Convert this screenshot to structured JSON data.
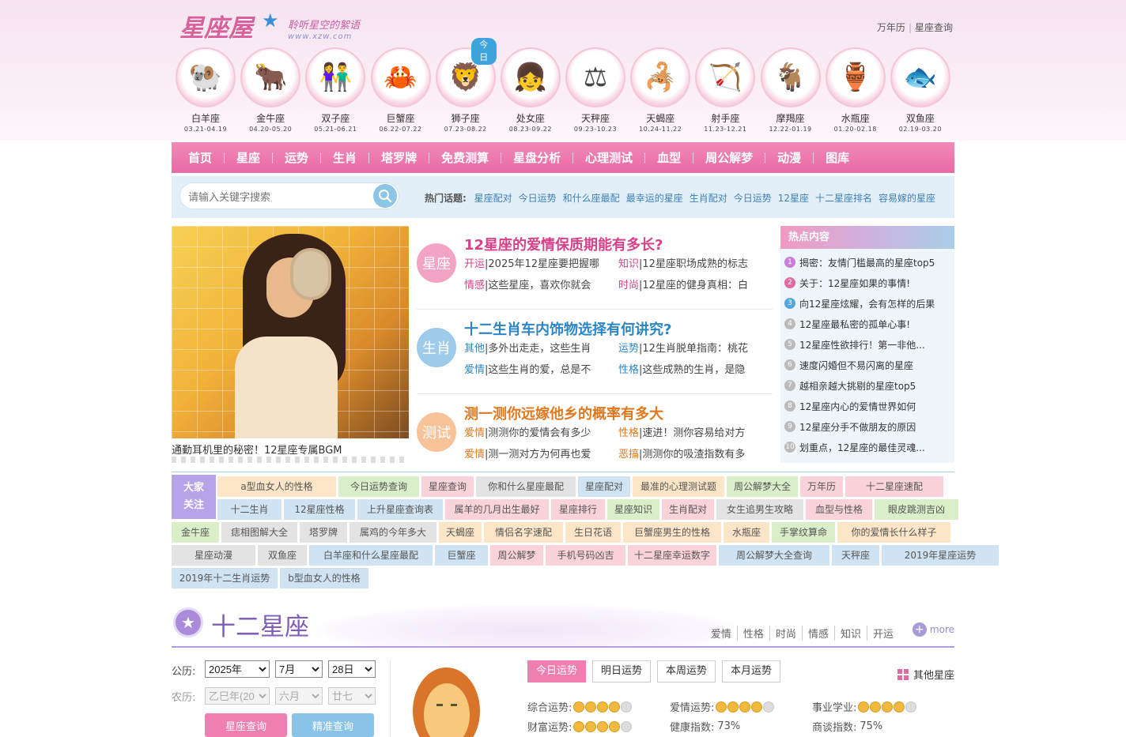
{
  "header": {
    "logo_text": "星座屋",
    "slogan": "聆听星空的絮语",
    "url": "www.xzw.com",
    "toplinks": [
      "万年历",
      "星座查询"
    ],
    "today_tag": "今日"
  },
  "signs": [
    {
      "name": "白羊座",
      "date": "03.21-04.19",
      "icon": "ram-icon"
    },
    {
      "name": "金牛座",
      "date": "04.20-05.20",
      "icon": "bull-icon"
    },
    {
      "name": "双子座",
      "date": "05.21-06.21",
      "icon": "twins-icon"
    },
    {
      "name": "巨蟹座",
      "date": "06.22-07.22",
      "icon": "crab-icon"
    },
    {
      "name": "狮子座",
      "date": "07.23-08.22",
      "icon": "lion-icon"
    },
    {
      "name": "处女座",
      "date": "08.23-09.22",
      "icon": "maiden-icon"
    },
    {
      "name": "天秤座",
      "date": "09.23-10.23",
      "icon": "scales-icon"
    },
    {
      "name": "天蝎座",
      "date": "10.24-11.22",
      "icon": "scorpion-icon"
    },
    {
      "name": "射手座",
      "date": "11.23-12.21",
      "icon": "archer-icon"
    },
    {
      "name": "摩羯座",
      "date": "12.22-01.19",
      "icon": "goat-icon"
    },
    {
      "name": "水瓶座",
      "date": "01.20-02.18",
      "icon": "water-bearer-icon"
    },
    {
      "name": "双鱼座",
      "date": "02.19-03.20",
      "icon": "fish-icon"
    }
  ],
  "nav": [
    "首页",
    "星座",
    "运势",
    "生肖",
    "塔罗牌",
    "免费测算",
    "星盘分析",
    "心理测试",
    "血型",
    "周公解梦",
    "动漫",
    "图库"
  ],
  "search": {
    "placeholder": "请输入关键字搜索",
    "hot_label": "热门话题:",
    "hot_topics": [
      "星座配对",
      "今日运势",
      "和什么座最配",
      "最幸运的星座",
      "生肖配对",
      "今日运势",
      "12星座",
      "十二星座排名",
      "容易嫁的星座"
    ]
  },
  "feature": {
    "caption": "通勤耳机里的秘密！12星座专属BGM"
  },
  "news": [
    {
      "badge": "星座",
      "badge_color": "#f3a4c4",
      "title_color": "#d7418a",
      "title": "12星座的爱情保质期能有多长?",
      "items": [
        {
          "k": "开运",
          "t": "2025年12星座要把握哪"
        },
        {
          "k": "知识",
          "t": "12星座职场成熟的标志"
        },
        {
          "k": "情感",
          "t": "这些星座，喜欢你就会"
        },
        {
          "k": "时尚",
          "t": "12星座的健身真相：白"
        }
      ]
    },
    {
      "badge": "生肖",
      "badge_color": "#9fcbea",
      "title_color": "#2c86c4",
      "title": "十二生肖车内饰物选择有何讲究?",
      "items": [
        {
          "k": "其他",
          "t": "多外出走走，这些生肖"
        },
        {
          "k": "运势",
          "t": "12生肖脱单指南：桃花"
        },
        {
          "k": "爱情",
          "t": "这些生肖的爱，总是不"
        },
        {
          "k": "性格",
          "t": "这些成熟的生肖，是隐"
        }
      ]
    },
    {
      "badge": "测试",
      "badge_color": "#f9c39a",
      "title_color": "#e0781e",
      "title": "测一测你远嫁他乡的概率有多大",
      "items": [
        {
          "k": "爱情",
          "t": "测测你的爱情会有多少"
        },
        {
          "k": "性格",
          "t": "速进！测你容易给对方"
        },
        {
          "k": "爱情",
          "t": "测一测对方为何再也爱"
        },
        {
          "k": "恶搞",
          "t": "测测你的吸渣指数有多"
        }
      ]
    }
  ],
  "hotlist": {
    "title": "热点内容",
    "items": [
      {
        "n": "1",
        "t": "揭密：友情门槛最高的星座top5",
        "c": "#c77fd8"
      },
      {
        "n": "2",
        "t": "关于：12星座如果的事情!",
        "c": "#e46aa3"
      },
      {
        "n": "3",
        "t": "向12星座炫耀，会有怎样的后果",
        "c": "#55a7db"
      },
      {
        "n": "4",
        "t": "12星座最私密的孤单心事!",
        "c": "#bbbbbb"
      },
      {
        "n": "5",
        "t": "12星座性欲排行！第一非他...",
        "c": "#bbbbbb"
      },
      {
        "n": "6",
        "t": "速度闪婚但不易闪离的星座",
        "c": "#bbbbbb"
      },
      {
        "n": "7",
        "t": "越相亲越大挑剔的星座top5",
        "c": "#bbbbbb"
      },
      {
        "n": "8",
        "t": "12星座内心的爱情世界如何",
        "c": "#bbbbbb"
      },
      {
        "n": "9",
        "t": "12星座分手不做朋友的原因",
        "c": "#bbbbbb"
      },
      {
        "n": "10",
        "t": "划重点，12星座的最佳灵魂...",
        "c": "#bbbbbb"
      }
    ]
  },
  "tags": {
    "title": [
      "大家",
      "关注"
    ],
    "rows": [
      [
        {
          "t": "a型血女人的性格",
          "c": "c1",
          "w": 150
        },
        {
          "t": "今日运势查询",
          "c": "c2",
          "w": 102
        },
        {
          "t": "星座查询",
          "c": "c4",
          "w": 66
        },
        {
          "t": "你和什么星座最配",
          "c": "c5",
          "w": 126
        },
        {
          "t": "星座配对",
          "c": "c3",
          "w": 66
        },
        {
          "t": "最准的心理测试题",
          "c": "c1",
          "w": 116
        },
        {
          "t": "周公解梦大全",
          "c": "c2",
          "w": 90
        },
        {
          "t": "万年历",
          "c": "c4",
          "w": 54
        },
        {
          "t": "十二星座速配",
          "c": "c4",
          "w": 124
        }
      ],
      [
        {
          "t": "十二生肖",
          "c": "c3",
          "w": 81
        },
        {
          "t": "12星座性格",
          "c": "c3",
          "w": 90
        },
        {
          "t": "上升星座查询表",
          "c": "c3",
          "w": 108
        },
        {
          "t": "属羊的几月出生最好",
          "c": "c4",
          "w": 131
        },
        {
          "t": "星座排行",
          "c": "c4",
          "w": 68
        },
        {
          "t": "星座知识",
          "c": "c2",
          "w": 66
        },
        {
          "t": "生肖配对",
          "c": "c4",
          "w": 66
        },
        {
          "t": "女生追男生攻略",
          "c": "c5",
          "w": 110
        },
        {
          "t": "血型与性格",
          "c": "c4",
          "w": 84
        },
        {
          "t": "眼皮跳测吉凶",
          "c": "c2",
          "w": 106
        }
      ]
    ],
    "rows_full": [
      [
        {
          "t": "金牛座",
          "c": "c2",
          "w": 60
        },
        {
          "t": "痣相图解大全",
          "c": "c5",
          "w": 96
        },
        {
          "t": "塔罗牌",
          "c": "c5",
          "w": 60
        },
        {
          "t": "属鸡的今年多大",
          "c": "c5",
          "w": 110
        },
        {
          "t": "天蝎座",
          "c": "c1",
          "w": 54
        },
        {
          "t": "情侣名字速配",
          "c": "c1",
          "w": 100
        },
        {
          "t": "生日花语",
          "c": "c1",
          "w": 70
        },
        {
          "t": "巨蟹座男生的性格",
          "c": "c1",
          "w": 124
        },
        {
          "t": "水瓶座",
          "c": "c1",
          "w": 58
        },
        {
          "t": "手掌纹算命",
          "c": "c2",
          "w": 80
        },
        {
          "t": "你的爱情长什么样子",
          "c": "c1",
          "w": 143
        }
      ],
      [
        {
          "t": "星座动漫",
          "c": "c5",
          "w": 106
        },
        {
          "t": "双鱼座",
          "c": "c5",
          "w": 62
        },
        {
          "t": "白羊座和什么星座最配",
          "c": "c3",
          "w": 156
        },
        {
          "t": "巨蟹座",
          "c": "c3",
          "w": 67
        },
        {
          "t": "周公解梦",
          "c": "c4",
          "w": 67
        },
        {
          "t": "手机号码凶吉",
          "c": "c4",
          "w": 101
        },
        {
          "t": "十二星座幸运数字",
          "c": "c4",
          "w": 112
        },
        {
          "t": "周公解梦大全查询",
          "c": "c3",
          "w": 140
        },
        {
          "t": "天秤座",
          "c": "c3",
          "w": 60
        },
        {
          "t": "2019年星座运势",
          "c": "c3",
          "w": 148
        }
      ],
      [
        {
          "t": "2019年十二生肖运势",
          "c": "c3",
          "w": 134
        },
        {
          "t": "b型血女人的性格",
          "c": "c3",
          "w": 112
        }
      ]
    ]
  },
  "section": {
    "title": "十二星座",
    "links": [
      "爱情",
      "性格",
      "时尚",
      "情感",
      "知识",
      "开运"
    ],
    "more": "more"
  },
  "calc": {
    "solar_label": "公历:",
    "lunar_label": "农历:",
    "year": "2025年",
    "month": "7月",
    "day": "28日",
    "lunar_year": "乙巳年(20",
    "lunar_month": "六月",
    "lunar_day": "廿七",
    "btn1": "星座查询",
    "btn2": "精准查询"
  },
  "fortune": {
    "tabs": [
      "今日运势",
      "明日运势",
      "本周运势",
      "本月运势"
    ],
    "other": "其他星座",
    "rows": [
      [
        {
          "label": "综合运势:",
          "stars": 4
        },
        {
          "label": "爱情运势:",
          "stars": 4
        },
        {
          "label": "事业学业:",
          "stars": 4
        }
      ],
      [
        {
          "label": "财富运势:",
          "stars": 4
        },
        {
          "label": "健康指数:",
          "value": "73%"
        },
        {
          "label": "商谈指数:",
          "value": "75%"
        }
      ]
    ]
  }
}
